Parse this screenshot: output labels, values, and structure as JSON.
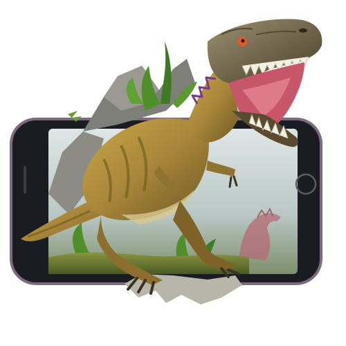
{
  "scene": {
    "subject": "t-rex-dinosaur",
    "device": "smartphone",
    "colors": {
      "background": "#ffffff",
      "phone_frame": "#1a1c22",
      "phone_edge": "#8a6f86",
      "screen_sky": "#c9d6d4",
      "ground": "#6e7a3a",
      "dino_body": "#b08a3a",
      "dino_stripes": "#6b5a1e",
      "dino_belly": "#d8c890",
      "dino_back": "#3f3a2a",
      "mouth": "#c8566a",
      "teeth": "#f3efe2",
      "foliage": "#4f8f2a",
      "rock": "#7a7a74"
    }
  }
}
